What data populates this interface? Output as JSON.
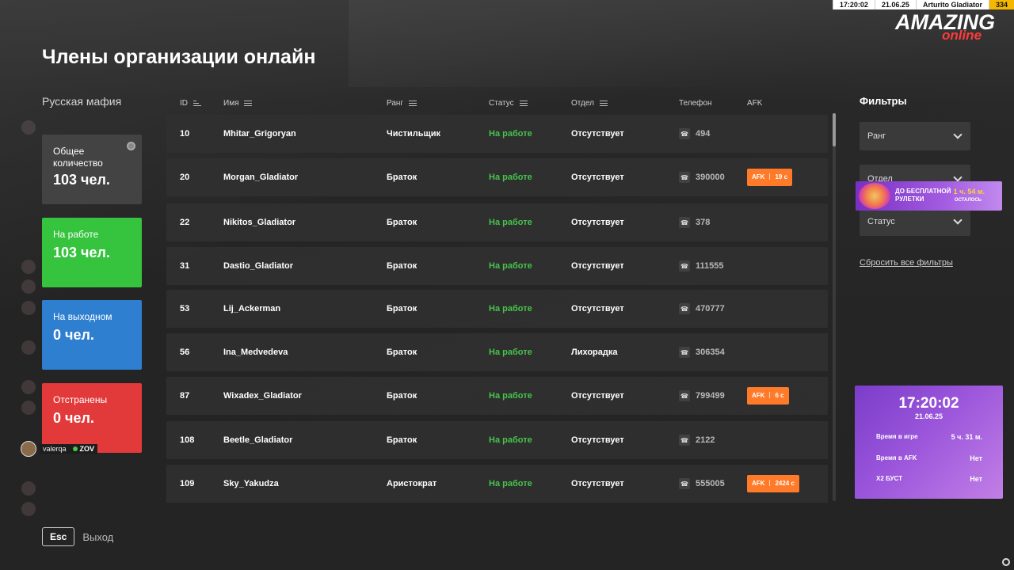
{
  "hud": {
    "time": "17:20:02",
    "date": "21.06.25",
    "player": "Arturito Gladiator",
    "level": "334"
  },
  "logo": {
    "main": "AMAZING",
    "sub": "online"
  },
  "page_title": "Члены организации онлайн",
  "org_name": "Русская мафия",
  "stats": {
    "total": {
      "label": "Общее количество",
      "value": "103 чел.",
      "color": "#464646"
    },
    "working": {
      "label": "На работе",
      "value": "103 чел.",
      "color": "#36c33e"
    },
    "day_off": {
      "label": "На выходном",
      "value": "0 чел.",
      "color": "#2f7fd1"
    },
    "suspended": {
      "label": "Отстранены",
      "value": "0 чел.",
      "color": "#e23a3a"
    }
  },
  "user_tag": {
    "name": "valerqa",
    "tag": "ZOV"
  },
  "escape": {
    "key": "Esc",
    "label": "Выход"
  },
  "table": {
    "headers": {
      "id": "ID",
      "name": "Имя",
      "rank": "Ранг",
      "status": "Статус",
      "department": "Отдел",
      "phone": "Телефон",
      "afk": "AFK"
    },
    "rows": [
      {
        "id": "10",
        "name": "Mhitar_Grigoryan",
        "rank": "Чистильщик",
        "status": "На работе",
        "department": "Отсутствует",
        "phone": "494",
        "afk": ""
      },
      {
        "id": "20",
        "name": "Morgan_Gladiator",
        "rank": "Браток",
        "status": "На работе",
        "department": "Отсутствует",
        "phone": "390000",
        "afk": "19 с"
      },
      {
        "id": "22",
        "name": "Nikitos_Gladiator",
        "rank": "Браток",
        "status": "На работе",
        "department": "Отсутствует",
        "phone": "378",
        "afk": ""
      },
      {
        "id": "31",
        "name": "Dastio_Gladiator",
        "rank": "Браток",
        "status": "На работе",
        "department": "Отсутствует",
        "phone": "111555",
        "afk": ""
      },
      {
        "id": "53",
        "name": "Lij_Ackerman",
        "rank": "Браток",
        "status": "На работе",
        "department": "Отсутствует",
        "phone": "470777",
        "afk": ""
      },
      {
        "id": "56",
        "name": "Ina_Medvedeva",
        "rank": "Браток",
        "status": "На работе",
        "department": "Лихорадка",
        "phone": "306354",
        "afk": ""
      },
      {
        "id": "87",
        "name": "Wixadex_Gladiator",
        "rank": "Браток",
        "status": "На работе",
        "department": "Отсутствует",
        "phone": "799499",
        "afk": "6 с"
      },
      {
        "id": "108",
        "name": "Beetle_Gladiator",
        "rank": "Браток",
        "status": "На работе",
        "department": "Отсутствует",
        "phone": "2122",
        "afk": ""
      },
      {
        "id": "109",
        "name": "Sky_Yakudza",
        "rank": "Аристократ",
        "status": "На работе",
        "department": "Отсутствует",
        "phone": "555005",
        "afk": "2424 с"
      }
    ],
    "afk_prefix": "AFK"
  },
  "filters": {
    "title": "Фильтры",
    "rank": "Ранг",
    "department": "Отдел",
    "status": "Статус",
    "reset": "Сбросить все фильтры"
  },
  "promo": {
    "text": "ДО БЕСПЛАТНОЙ РУЛЕТКИ",
    "time": "1 ч. 54 м.",
    "note": "ОСТАЛОСЬ"
  },
  "time_card": {
    "clock": "17:20:02",
    "date": "21.06.25",
    "in_game_label": "Время в игре",
    "in_game_value": "5 ч. 31 м.",
    "afk_label": "Время в AFK",
    "afk_value": "Нет",
    "boost_label": "X2 БУСТ",
    "boost_value": "Нет"
  },
  "colors": {
    "status_green": "#45c44b",
    "afk_orange": "#ff7a29",
    "accent_purple": "#9a55db"
  }
}
